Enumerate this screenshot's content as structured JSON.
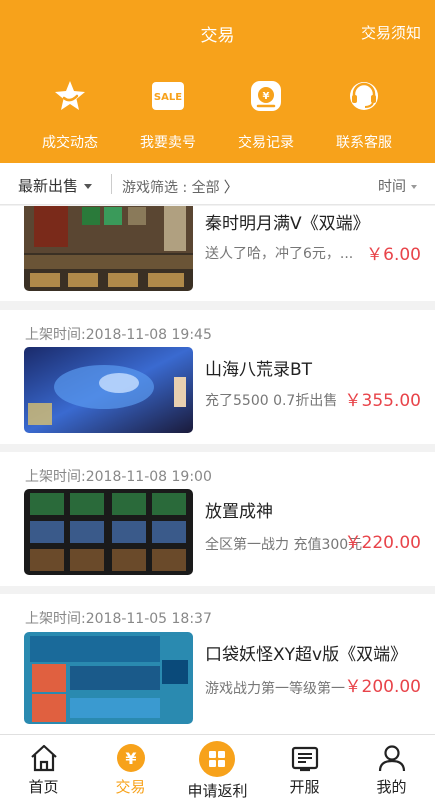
{
  "header": {
    "title": "交易",
    "notice": "交易须知",
    "background": "#f7a21b"
  },
  "quick_actions": [
    {
      "label": "成交动态",
      "icon": "star-icon"
    },
    {
      "label": "我要卖号",
      "icon": "sale-tag-icon"
    },
    {
      "label": "交易记录",
      "icon": "yuan-record-icon"
    },
    {
      "label": "联系客服",
      "icon": "customer-service-icon"
    }
  ],
  "filters": {
    "sort": "最新出售",
    "game_filter": "游戏筛选 : 全部",
    "time": "时间"
  },
  "listings": [
    {
      "time": "",
      "name": "秦时明月满V《双端》",
      "desc": "送人了哈，冲了6元，...",
      "price": "￥6.00"
    },
    {
      "time": "上架时间:2018-11-08 19:45",
      "name": "山海八荒录BT",
      "desc": "充了5500  0.7折出售",
      "price": "￥355.00"
    },
    {
      "time": "上架时间:2018-11-08 19:00",
      "name": "放置成神",
      "desc": "全区第一战力  充值300元",
      "price": "￥220.00"
    },
    {
      "time": "上架时间:2018-11-05 18:37",
      "name": "口袋妖怪XY超v版《双端》",
      "desc": "游戏战力第一等级第一",
      "price": "￥200.00"
    }
  ],
  "tabs": [
    {
      "label": "首页",
      "icon": "home-icon"
    },
    {
      "label": "交易",
      "icon": "yuan-coin-icon"
    },
    {
      "label": "申请返利",
      "icon": "rebate-grid-icon"
    },
    {
      "label": "开服",
      "icon": "server-news-icon"
    },
    {
      "label": "我的",
      "icon": "user-icon"
    }
  ],
  "accent_color": "#f7a21b",
  "price_color": "#e8444a"
}
